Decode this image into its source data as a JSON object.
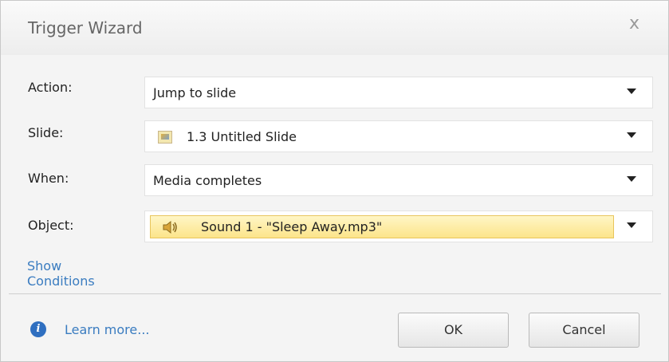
{
  "window": {
    "title": "Trigger Wizard",
    "close_glyph": "x"
  },
  "form": {
    "action": {
      "label": "Action:",
      "value": "Jump to slide"
    },
    "slide": {
      "label": "Slide:",
      "value": "1.3 Untitled Slide",
      "icon": "slide-thumbnail-icon"
    },
    "when": {
      "label": "When:",
      "value": "Media completes"
    },
    "object": {
      "label": "Object:",
      "value": "Sound 1 - \"Sleep Away.mp3\"",
      "icon": "speaker-icon"
    }
  },
  "links": {
    "show_conditions": "Show Conditions",
    "learn_more": "Learn more..."
  },
  "buttons": {
    "ok": "OK",
    "cancel": "Cancel"
  },
  "colors": {
    "link": "#3a7cc0",
    "highlight": "#fce48a",
    "info": "#2f6fc0"
  }
}
